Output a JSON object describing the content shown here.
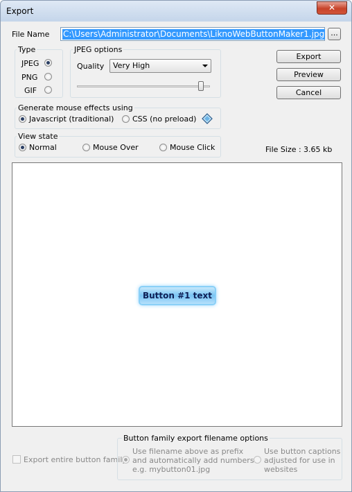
{
  "window": {
    "title": "Export",
    "close_label": "✕"
  },
  "file": {
    "label": "File Name",
    "value": "C:\\Users\\Administrator\\Documents\\LiknoWebButtonMaker1.jpg",
    "browse_label": "..."
  },
  "type_group": {
    "label": "Type",
    "options": [
      "JPEG",
      "PNG",
      "GIF"
    ],
    "selected": "JPEG"
  },
  "jpeg_options": {
    "label": "JPEG options",
    "quality_label": "Quality",
    "quality_value": "Very High",
    "quality_level": 0.95
  },
  "actions": {
    "export_label": "Export",
    "preview_label": "Preview",
    "cancel_label": "Cancel"
  },
  "mouse_effects": {
    "label": "Generate mouse effects using",
    "options": [
      "Javascript (traditional)",
      "CSS (no preload)"
    ],
    "selected": "Javascript (traditional)"
  },
  "view_state": {
    "label": "View state",
    "options": [
      "Normal",
      "Mouse Over",
      "Mouse Click"
    ],
    "selected": "Normal"
  },
  "file_size": {
    "label": "File Size :",
    "value": "3.65 kb"
  },
  "preview": {
    "button_text": "Button #1 text"
  },
  "family": {
    "checkbox_label": "Export entire button family",
    "options_label": "Button family export filename options",
    "option_prefix": [
      "Use filename above as prefix",
      "and automatically add numbers",
      "e.g. mybutton01.jpg"
    ],
    "option_captions": [
      "Use button captions",
      "adjusted for use in",
      "websites"
    ]
  },
  "colors": {
    "selection": "#3399ff",
    "button_text": "#0e1f55",
    "button_glow": "#79c4f4"
  }
}
